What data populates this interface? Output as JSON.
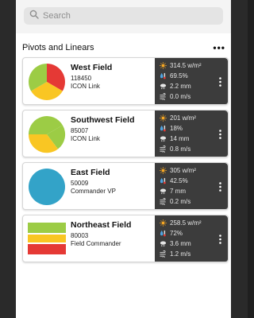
{
  "search": {
    "placeholder": "Search"
  },
  "section": {
    "title": "Pivots and Linears"
  },
  "colors": {
    "red": "#e53935",
    "yellow": "#f9c623",
    "green": "#9ccc45",
    "blue": "#33a3c8",
    "stats_bg": "#3c3c3c"
  },
  "fields": [
    {
      "name": "West Field",
      "id": "118450",
      "device": "ICON Link",
      "icon": "pivot-pie-icon",
      "solar": "314.5 w/m²",
      "humidity": "69.5%",
      "rain": "2.2 mm",
      "wind": "0.0 m/s"
    },
    {
      "name": "Southwest Field",
      "id": "85007",
      "device": "ICON Link",
      "icon": "pivot-pie-icon",
      "solar": "201 w/m²",
      "humidity": "18%",
      "rain": "14 mm",
      "wind": "0.8 m/s"
    },
    {
      "name": "East Field",
      "id": "50009",
      "device": "Commander VP",
      "icon": "pivot-circle-icon",
      "solar": "305 w/m²",
      "humidity": "42.5%",
      "rain": "7 mm",
      "wind": "0.2 m/s"
    },
    {
      "name": "Northeast Field",
      "id": "80003",
      "device": "Field Commander",
      "icon": "linear-bars-icon",
      "solar": "258.5 w/m²",
      "humidity": "72%",
      "rain": "3.6 mm",
      "wind": "1.2 m/s"
    }
  ]
}
